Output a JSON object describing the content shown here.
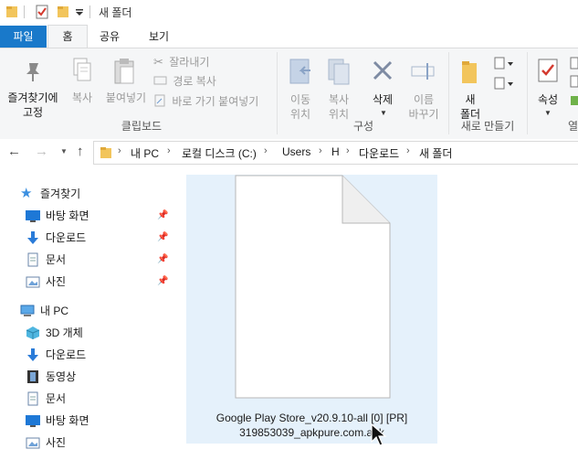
{
  "window": {
    "title": "새 폴더"
  },
  "tabs": [
    {
      "label": "파일"
    },
    {
      "label": "홈"
    },
    {
      "label": "공유"
    },
    {
      "label": "보기"
    }
  ],
  "ribbon": {
    "pin_quick_access": "즐겨찾기에\n고정",
    "copy": "복사",
    "paste": "붙여넣기",
    "cut": "잘라내기",
    "copy_path": "경로 복사",
    "paste_shortcut": "바로 가기 붙여넣기",
    "clipboard_group": "클립보드",
    "move_to": "이동\n위치",
    "copy_to": "복사\n위치",
    "delete": "삭제",
    "rename": "이름\n바꾸기",
    "organize_group": "구성",
    "new_folder": "새\n폴더",
    "new_group": "새로 만들기",
    "properties": "속성",
    "open_group_partial": "열"
  },
  "address": {
    "crumbs": [
      "내 PC",
      "로컬 디스크 (C:)",
      "Users",
      "H",
      "다운로드",
      "새 폴더"
    ]
  },
  "sidebar": {
    "quick_access": "즐겨찾기",
    "quick_items": [
      {
        "label": "바탕 화면",
        "pinned": true
      },
      {
        "label": "다운로드",
        "pinned": true
      },
      {
        "label": "문서",
        "pinned": true
      },
      {
        "label": "사진",
        "pinned": true
      }
    ],
    "this_pc": "내 PC",
    "pc_items": [
      {
        "label": "3D 개체"
      },
      {
        "label": "다운로드"
      },
      {
        "label": "동영상"
      },
      {
        "label": "문서"
      },
      {
        "label": "바탕 화면"
      },
      {
        "label": "사진"
      }
    ]
  },
  "files": [
    {
      "name_line1": "Google Play Store_v20.9.10-all [0] [PR]",
      "name_line2": "319853039_apkpure.com.apk",
      "selected": true
    }
  ],
  "colors": {
    "file_tab": "#1979ca",
    "selection": "#e5f1fb",
    "accent": "#0078d7"
  }
}
